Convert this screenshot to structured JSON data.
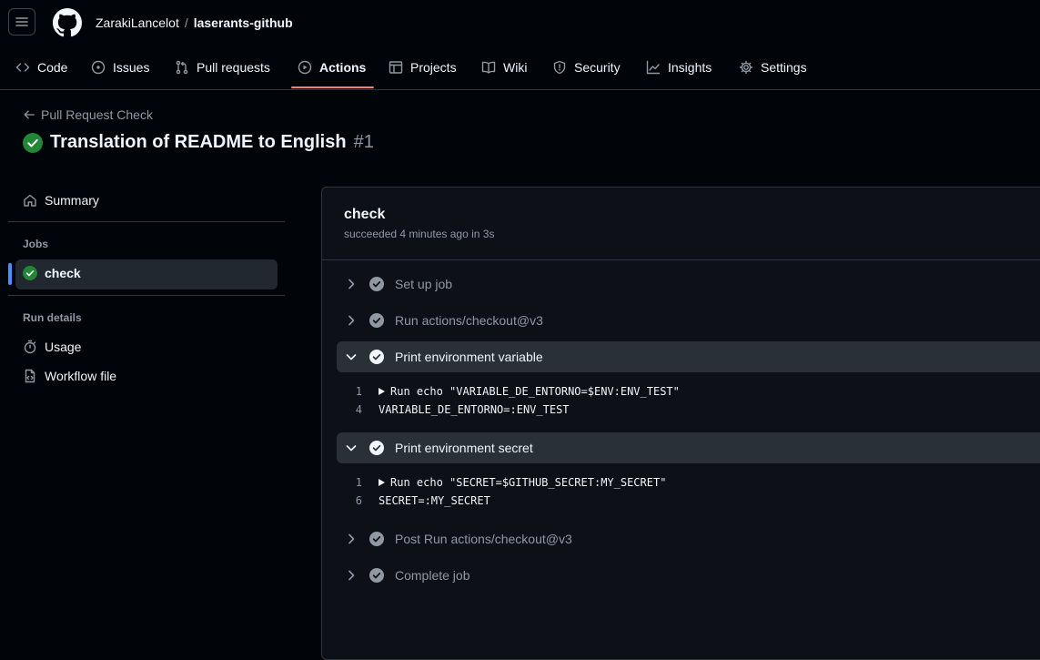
{
  "repo": {
    "owner": "ZarakiLancelot",
    "separator": "/",
    "name": "laserants-github"
  },
  "tabs": [
    {
      "label": "Code",
      "icon": "code-icon"
    },
    {
      "label": "Issues",
      "icon": "issue-icon"
    },
    {
      "label": "Pull requests",
      "icon": "pull-request-icon"
    },
    {
      "label": "Actions",
      "icon": "play-icon",
      "active": true
    },
    {
      "label": "Projects",
      "icon": "table-icon"
    },
    {
      "label": "Wiki",
      "icon": "book-icon"
    },
    {
      "label": "Security",
      "icon": "shield-icon"
    },
    {
      "label": "Insights",
      "icon": "graph-icon"
    },
    {
      "label": "Settings",
      "icon": "gear-icon"
    }
  ],
  "run": {
    "back_label": "Pull Request Check",
    "title": "Translation of README to English",
    "number": "#1",
    "status": "success"
  },
  "sidebar": {
    "summary_label": "Summary",
    "jobs_heading": "Jobs",
    "job_label": "check",
    "run_details_heading": "Run details",
    "usage_label": "Usage",
    "workflow_file_label": "Workflow file"
  },
  "job": {
    "name": "check",
    "meta": "succeeded 4 minutes ago in 3s",
    "steps": [
      {
        "label": "Set up job",
        "expanded": false
      },
      {
        "label": "Run actions/checkout@v3",
        "expanded": false
      },
      {
        "label": "Print environment variable",
        "expanded": true,
        "log": [
          {
            "line": "1",
            "text": "Run echo \"VARIABLE_DE_ENTORNO=$ENV:ENV_TEST\"",
            "collapsible": true
          },
          {
            "line": "4",
            "text": "VARIABLE_DE_ENTORNO=:ENV_TEST",
            "collapsible": false
          }
        ]
      },
      {
        "label": "Print environment secret",
        "expanded": true,
        "log": [
          {
            "line": "1",
            "text": "Run echo \"SECRET=$GITHUB_SECRET:MY_SECRET\"",
            "collapsible": true
          },
          {
            "line": "6",
            "text": "SECRET=:MY_SECRET",
            "collapsible": false
          }
        ]
      },
      {
        "label": "Post Run actions/checkout@v3",
        "expanded": false
      },
      {
        "label": "Complete job",
        "expanded": false
      }
    ]
  },
  "colors": {
    "success": "#238636",
    "step_done": "#9198a1",
    "active_tab_underline": "#f78166",
    "active_job_marker": "#4493f8"
  }
}
